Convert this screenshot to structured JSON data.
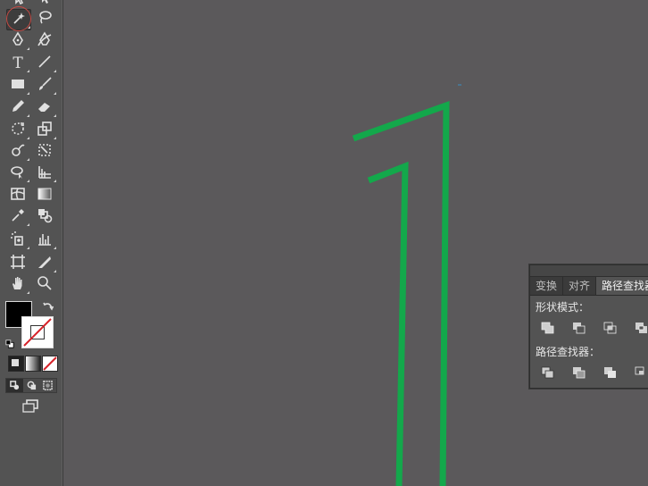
{
  "toolbar": {
    "tools": [
      {
        "name": "selection-tool-icon"
      },
      {
        "name": "direct-selection-tool-icon"
      },
      {
        "name": "magic-wand-tool-icon",
        "selected": true
      },
      {
        "name": "lasso-tool-icon"
      },
      {
        "name": "pen-tool-icon"
      },
      {
        "name": "curvature-tool-icon"
      },
      {
        "name": "type-tool-icon"
      },
      {
        "name": "line-segment-tool-icon"
      },
      {
        "name": "rectangle-tool-icon"
      },
      {
        "name": "paintbrush-tool-icon"
      },
      {
        "name": "pencil-tool-icon"
      },
      {
        "name": "eraser-tool-icon"
      },
      {
        "name": "rotate-tool-icon"
      },
      {
        "name": "scale-tool-icon"
      },
      {
        "name": "warp-tool-icon"
      },
      {
        "name": "free-transform-tool-icon"
      },
      {
        "name": "shape-builder-tool-icon"
      },
      {
        "name": "perspective-grid-tool-icon"
      },
      {
        "name": "mesh-tool-icon"
      },
      {
        "name": "gradient-tool-icon"
      },
      {
        "name": "eyedropper-tool-icon"
      },
      {
        "name": "blend-tool-icon"
      },
      {
        "name": "symbol-sprayer-tool-icon"
      },
      {
        "name": "column-graph-tool-icon"
      },
      {
        "name": "artboard-tool-icon"
      },
      {
        "name": "slice-tool-icon"
      },
      {
        "name": "hand-tool-icon"
      },
      {
        "name": "zoom-tool-icon"
      }
    ],
    "type_tool_glyph": "T",
    "fill_color": "#000000",
    "stroke_color": "none",
    "highlight_color": "#c64a44"
  },
  "panel": {
    "tabs": [
      "变换",
      "对齐",
      "路径查找器"
    ],
    "active_tab": "路径查找器",
    "shape_modes_label": "形状模式：",
    "pathfinders_label": "路径查找器："
  },
  "artwork": {
    "stroke_color": "#13a84b"
  }
}
